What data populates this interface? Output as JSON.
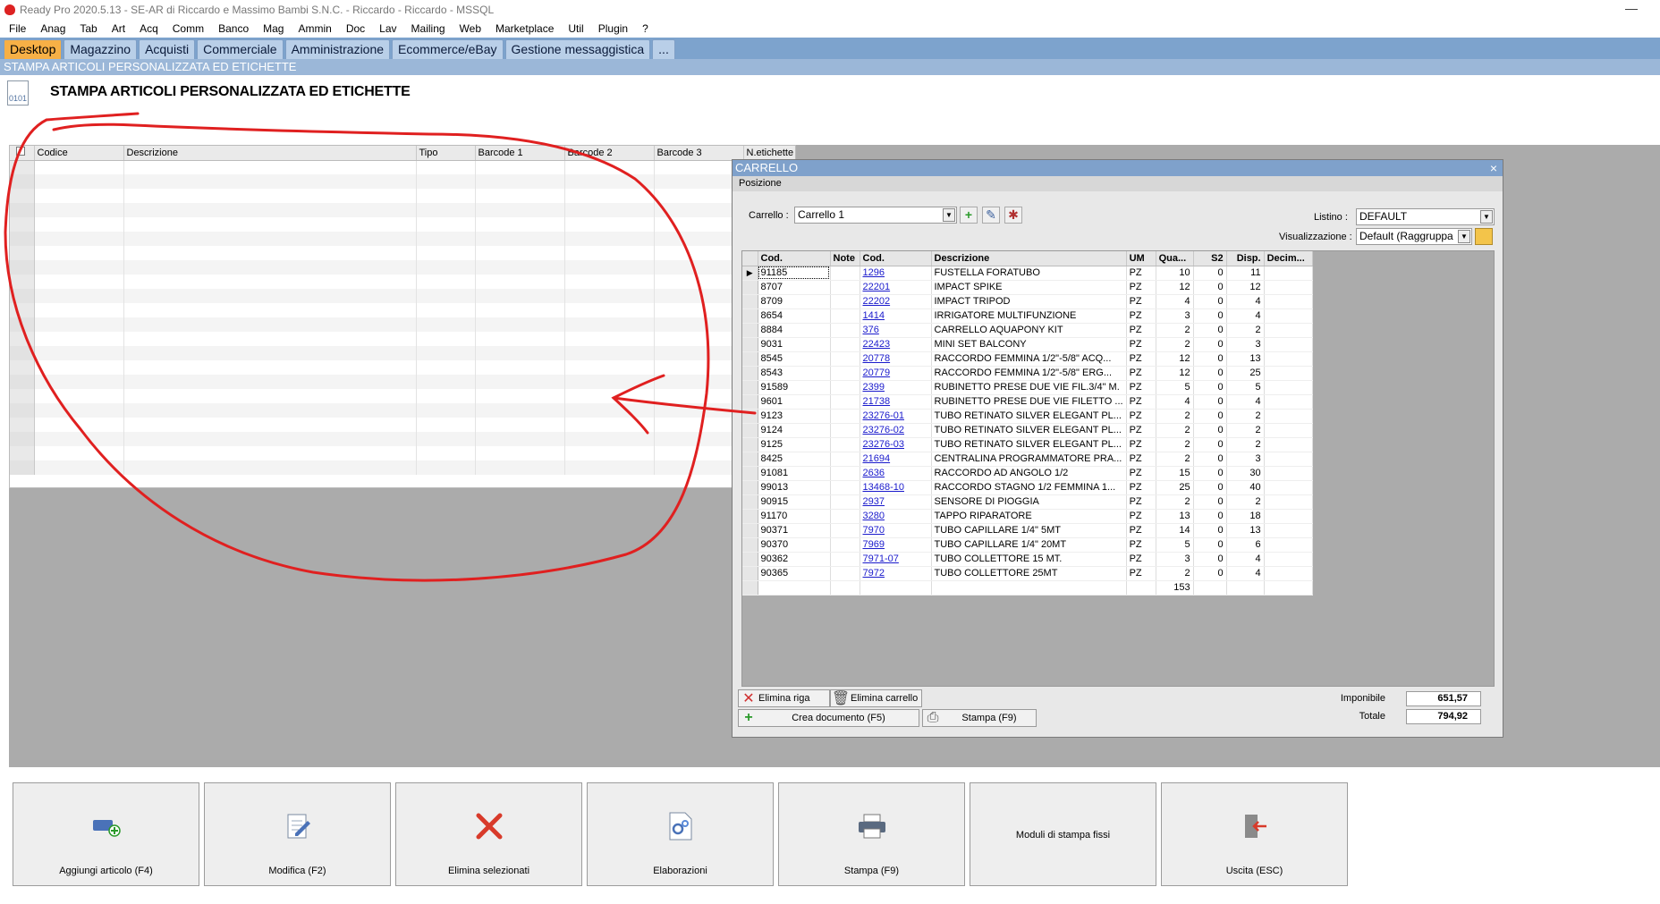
{
  "window": {
    "title": "Ready Pro 2020.5.13 - SE-AR di Riccardo e Massimo Bambi S.N.C. - Riccardo - Riccardo - MSSQL",
    "minimize": "—"
  },
  "menu": [
    "File",
    "Anag",
    "Tab",
    "Art",
    "Acq",
    "Comm",
    "Banco",
    "Mag",
    "Ammin",
    "Doc",
    "Lav",
    "Mailing",
    "Web",
    "Marketplace",
    "Util",
    "Plugin",
    "?"
  ],
  "module_tabs": [
    "Desktop",
    "Magazzino",
    "Acquisti",
    "Commerciale",
    "Amministrazione",
    "Ecommerce/eBay",
    "Gestione messaggistica",
    "..."
  ],
  "subheader": "STAMPA ARTICOLI PERSONALIZZATA ED ETICHETTE",
  "page_icon_text": "0101",
  "page_title": "STAMPA ARTICOLI PERSONALIZZATA ED ETICHETTE",
  "left_grid": {
    "columns": [
      "Codice",
      "Descrizione",
      "Tipo",
      "Barcode 1",
      "Barcode 2",
      "Barcode 3",
      "N.etichette"
    ]
  },
  "carrello": {
    "title": "CARRELLO",
    "close": "×",
    "section": "Posizione",
    "carrello_label": "Carrello :",
    "carrello_value": "Carrello 1",
    "listino_label": "Listino :",
    "listino_value": "DEFAULT",
    "visualizzazione_label": "Visualizzazione :",
    "visualizzazione_value": "Default (Raggruppa",
    "columns": [
      "Cod.",
      "Note",
      "Cod.",
      "Descrizione",
      "UM",
      "Qua...",
      "S2",
      "Disp.",
      "Decim..."
    ],
    "rows": [
      [
        "91185",
        "",
        "1296",
        "FUSTELLA FORATUBO",
        "PZ",
        "10",
        "0",
        "11"
      ],
      [
        "8707",
        "",
        "22201",
        "IMPACT SPIKE",
        "PZ",
        "12",
        "0",
        "12"
      ],
      [
        "8709",
        "",
        "22202",
        "IMPACT TRIPOD",
        "PZ",
        "4",
        "0",
        "4"
      ],
      [
        "8654",
        "",
        "1414",
        "IRRIGATORE MULTIFUNZIONE",
        "PZ",
        "3",
        "0",
        "4"
      ],
      [
        "8884",
        "",
        "376",
        "CARRELLO AQUAPONY KIT",
        "PZ",
        "2",
        "0",
        "2"
      ],
      [
        "9031",
        "",
        "22423",
        "MINI SET BALCONY",
        "PZ",
        "2",
        "0",
        "3"
      ],
      [
        "8545",
        "",
        "20778",
        "RACCORDO FEMMINA 1/2\"-5/8\" ACQ...",
        "PZ",
        "12",
        "0",
        "13"
      ],
      [
        "8543",
        "",
        "20779",
        "RACCORDO FEMMINA 1/2\"-5/8\" ERG...",
        "PZ",
        "12",
        "0",
        "25"
      ],
      [
        "91589",
        "",
        "2399",
        "RUBINETTO PRESE DUE VIE FIL.3/4\" M.",
        "PZ",
        "5",
        "0",
        "5"
      ],
      [
        "9601",
        "",
        "21738",
        "RUBINETTO PRESE DUE VIE FILETTO ...",
        "PZ",
        "4",
        "0",
        "4"
      ],
      [
        "9123",
        "",
        "23276-01",
        "TUBO RETINATO SILVER ELEGANT PL...",
        "PZ",
        "2",
        "0",
        "2"
      ],
      [
        "9124",
        "",
        "23276-02",
        "TUBO RETINATO SILVER ELEGANT PL...",
        "PZ",
        "2",
        "0",
        "2"
      ],
      [
        "9125",
        "",
        "23276-03",
        "TUBO RETINATO SILVER ELEGANT PL...",
        "PZ",
        "2",
        "0",
        "2"
      ],
      [
        "8425",
        "",
        "21694",
        "CENTRALINA PROGRAMMATORE PRA...",
        "PZ",
        "2",
        "0",
        "3"
      ],
      [
        "91081",
        "",
        "2636",
        "RACCORDO AD ANGOLO 1/2",
        "PZ",
        "15",
        "0",
        "30"
      ],
      [
        "99013",
        "",
        "13468-10",
        "RACCORDO STAGNO 1/2 FEMMINA 1...",
        "PZ",
        "25",
        "0",
        "40"
      ],
      [
        "90915",
        "",
        "2937",
        "SENSORE DI PIOGGIA",
        "PZ",
        "2",
        "0",
        "2"
      ],
      [
        "91170",
        "",
        "3280",
        "TAPPO RIPARATORE",
        "PZ",
        "13",
        "0",
        "18"
      ],
      [
        "90371",
        "",
        "7970",
        "TUBO CAPILLARE 1/4\"  5MT",
        "PZ",
        "14",
        "0",
        "13"
      ],
      [
        "90370",
        "",
        "7969",
        "TUBO CAPILLARE 1/4\" 20MT",
        "PZ",
        "5",
        "0",
        "6"
      ],
      [
        "90362",
        "",
        "7971-07",
        "TUBO COLLETTORE 15 MT.",
        "PZ",
        "3",
        "0",
        "4"
      ],
      [
        "90365",
        "",
        "7972",
        "TUBO COLLETTORE 25MT",
        "PZ",
        "2",
        "0",
        "4"
      ]
    ],
    "qty_total": "153",
    "btn_elimina_riga": "Elimina riga",
    "btn_elimina_carrello": "Elimina carrello",
    "btn_crea_documento": "Crea documento (F5)",
    "btn_stampa": "Stampa (F9)",
    "imponibile_label": "Imponibile",
    "imponibile_value": "651,57",
    "totale_label": "Totale",
    "totale_value": "794,92"
  },
  "bottom_buttons": [
    {
      "label": "Aggiungi articolo (F4)",
      "icon": "add-article-icon"
    },
    {
      "label": "Modifica (F2)",
      "icon": "edit-icon"
    },
    {
      "label": "Elimina selezionati",
      "icon": "delete-icon"
    },
    {
      "label": "Elaborazioni",
      "icon": "process-icon"
    },
    {
      "label": "Stampa (F9)",
      "icon": "printer-icon"
    },
    {
      "label": "Moduli di stampa fissi",
      "icon": ""
    },
    {
      "label": "Uscita (ESC)",
      "icon": "exit-icon"
    }
  ],
  "colors": {
    "tab_bar": "#7da3cd",
    "active_tab": "#f7b046",
    "grid_area": "#ababab",
    "annotation": "#e02020",
    "link": "#1a1acc"
  }
}
